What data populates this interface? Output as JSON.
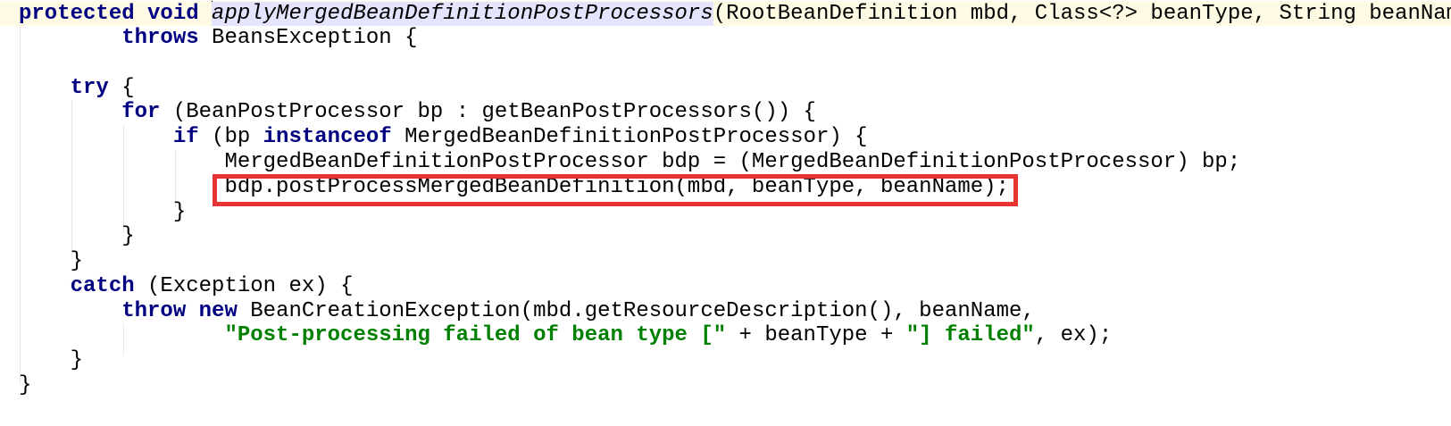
{
  "editor": {
    "caret_line": 0,
    "highlighted_line": 7,
    "lines": [
      [
        {
          "t": "protected",
          "c": "kw"
        },
        {
          "t": " "
        },
        {
          "t": "void",
          "c": "kw"
        },
        {
          "t": " "
        },
        {
          "t": "applyMergedBeanDefinitionPostProcessors",
          "c": "ital hl-ident",
          "caret": true
        },
        {
          "t": "(RootBeanDefinition mbd, Class<?> beanType, String beanName)"
        }
      ],
      [
        {
          "t": "        "
        },
        {
          "t": "throws",
          "c": "kw"
        },
        {
          "t": " BeansException {"
        }
      ],
      [
        {
          "t": ""
        }
      ],
      [
        {
          "t": "    "
        },
        {
          "t": "try",
          "c": "kw"
        },
        {
          "t": " {"
        }
      ],
      [
        {
          "t": "        "
        },
        {
          "t": "for",
          "c": "kw"
        },
        {
          "t": " (BeanPostProcessor bp : getBeanPostProcessors()) {"
        }
      ],
      [
        {
          "t": "            "
        },
        {
          "t": "if",
          "c": "kw"
        },
        {
          "t": " (bp "
        },
        {
          "t": "instanceof",
          "c": "kw"
        },
        {
          "t": " MergedBeanDefinitionPostProcessor) {"
        }
      ],
      [
        {
          "t": "                MergedBeanDefinitionPostProcessor bdp = (MergedBeanDefinitionPostProcessor) bp;"
        }
      ],
      [
        {
          "t": "                bdp.postProcessMergedBeanDefinition(mbd, beanType, beanName);"
        }
      ],
      [
        {
          "t": "            }"
        }
      ],
      [
        {
          "t": "        }"
        }
      ],
      [
        {
          "t": "    }"
        }
      ],
      [
        {
          "t": "    "
        },
        {
          "t": "catch",
          "c": "kw"
        },
        {
          "t": " (Exception ex) {"
        }
      ],
      [
        {
          "t": "        "
        },
        {
          "t": "throw",
          "c": "kw"
        },
        {
          "t": " "
        },
        {
          "t": "new",
          "c": "kw"
        },
        {
          "t": " BeanCreationException(mbd.getResourceDescription(), beanName,"
        }
      ],
      [
        {
          "t": "                "
        },
        {
          "t": "\"Post-processing failed of bean type [\"",
          "c": "str"
        },
        {
          "t": " + beanType + "
        },
        {
          "t": "\"] failed\"",
          "c": "str"
        },
        {
          "t": ", ex);"
        }
      ],
      [
        {
          "t": "    }"
        }
      ],
      [
        {
          "t": "}"
        }
      ]
    ]
  }
}
